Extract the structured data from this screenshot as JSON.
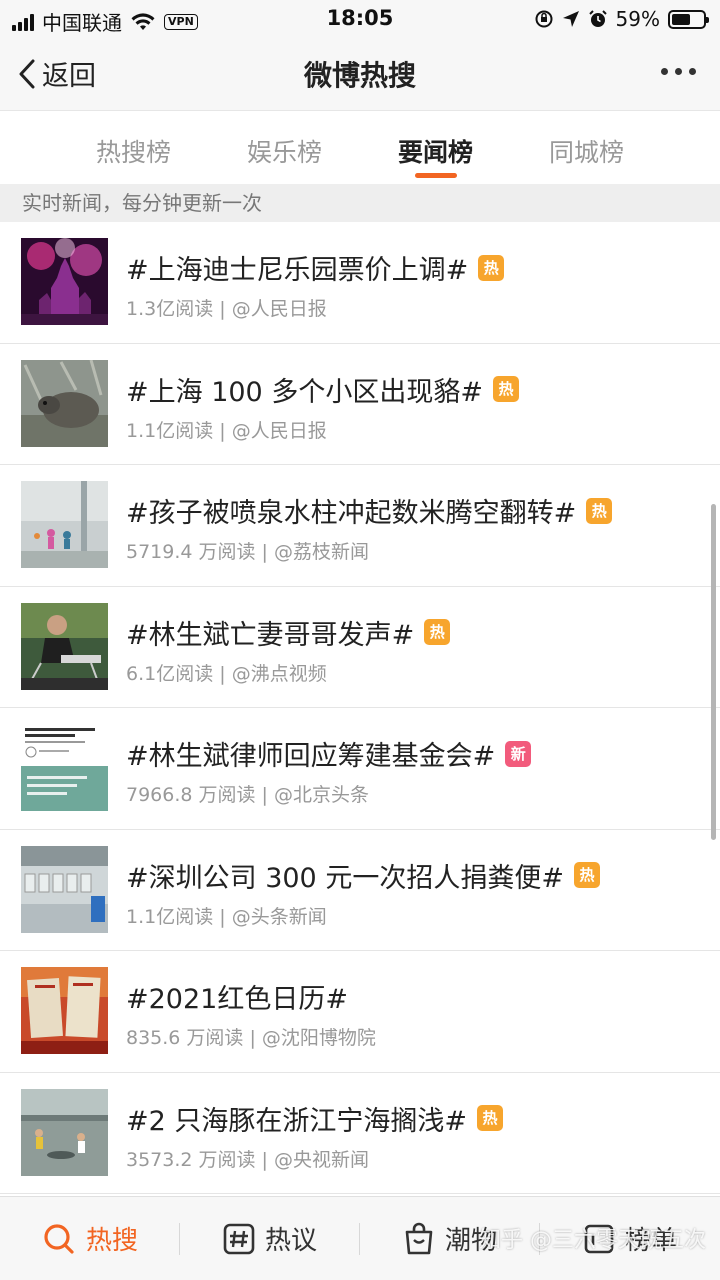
{
  "status": {
    "carrier": "中国联通",
    "vpn": "VPN",
    "time": "18:05",
    "battery": "59%",
    "battery_level": 0.59
  },
  "header": {
    "back_label": "返回",
    "title": "微博热搜"
  },
  "tabs": [
    {
      "label": "热搜榜",
      "active": false
    },
    {
      "label": "娱乐榜",
      "active": false
    },
    {
      "label": "要闻榜",
      "active": true
    },
    {
      "label": "同城榜",
      "active": false
    }
  ],
  "subtitle": "实时新闻，每分钟更新一次",
  "items": [
    {
      "title": "#上海迪士尼乐园票价上调#",
      "badge": "热",
      "badge_type": "hot",
      "meta": "1.3亿阅读 | @人民日报"
    },
    {
      "title": "#上海 100 多个小区出现貉#",
      "badge": "热",
      "badge_type": "hot",
      "meta": "1.1亿阅读 | @人民日报"
    },
    {
      "title": "#孩子被喷泉水柱冲起数米腾空翻转#",
      "badge": "热",
      "badge_type": "hot",
      "meta": "5719.4 万阅读 | @荔枝新闻"
    },
    {
      "title": "#林生斌亡妻哥哥发声#",
      "badge": "热",
      "badge_type": "hot",
      "meta": "6.1亿阅读 | @沸点视频"
    },
    {
      "title": "#林生斌律师回应筹建基金会#",
      "badge": "新",
      "badge_type": "new",
      "meta": "7966.8 万阅读 | @北京头条"
    },
    {
      "title": "#深圳公司 300 元一次招人捐粪便#",
      "badge": "热",
      "badge_type": "hot",
      "meta": "1.1亿阅读 | @头条新闻"
    },
    {
      "title": "#2021红色日历#",
      "badge": "",
      "badge_type": "",
      "meta": "835.6 万阅读 | @沈阳博物院"
    },
    {
      "title": "#2 只海豚在浙江宁海搁浅#",
      "badge": "热",
      "badge_type": "hot",
      "meta": "3573.2 万阅读 | @央视新闻"
    }
  ],
  "bottom_nav": [
    {
      "label": "热搜",
      "icon": "search-icon",
      "active": true
    },
    {
      "label": "热议",
      "icon": "hashtag-icon",
      "active": false
    },
    {
      "label": "潮物",
      "icon": "shopping-bag-icon",
      "active": false
    },
    {
      "label": "榜单",
      "icon": "list-icon",
      "active": false
    }
  ],
  "watermark": "知乎 @三六零天既五次",
  "colors": {
    "accent": "#f26522",
    "hot_badge": "#f7a52d",
    "new_badge": "#f25b7c"
  }
}
